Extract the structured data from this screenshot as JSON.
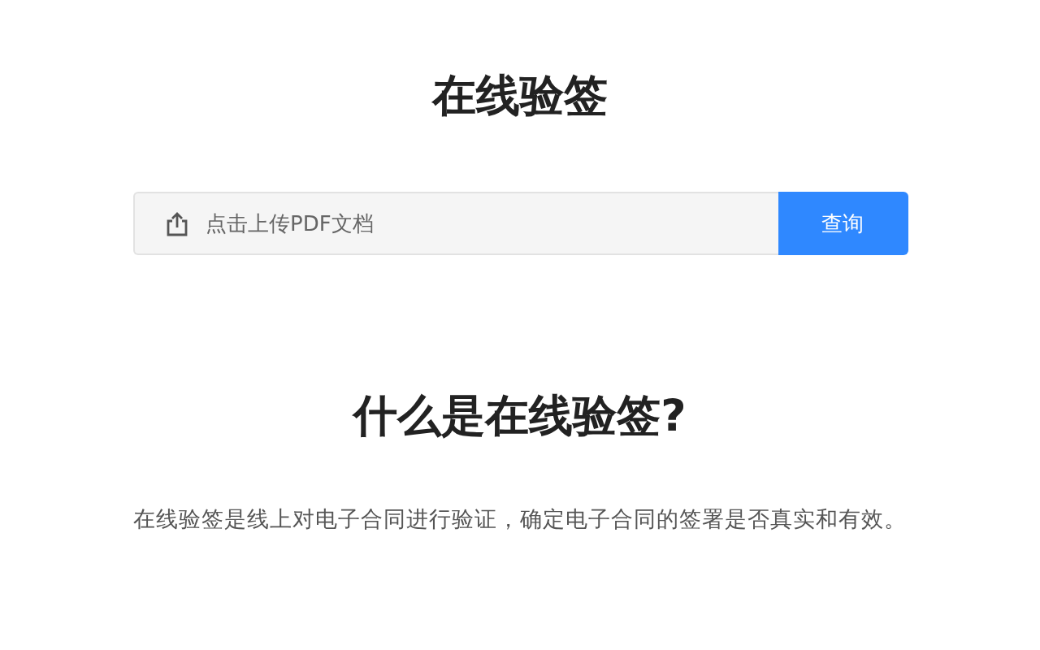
{
  "title": "在线验签",
  "upload": {
    "placeholder": "点击上传PDF文档",
    "button": "查询"
  },
  "section": {
    "heading": "什么是在线验签?",
    "text": "在线验签是线上对电子合同进行验证，确定电子合同的签署是否真实和有效。"
  }
}
